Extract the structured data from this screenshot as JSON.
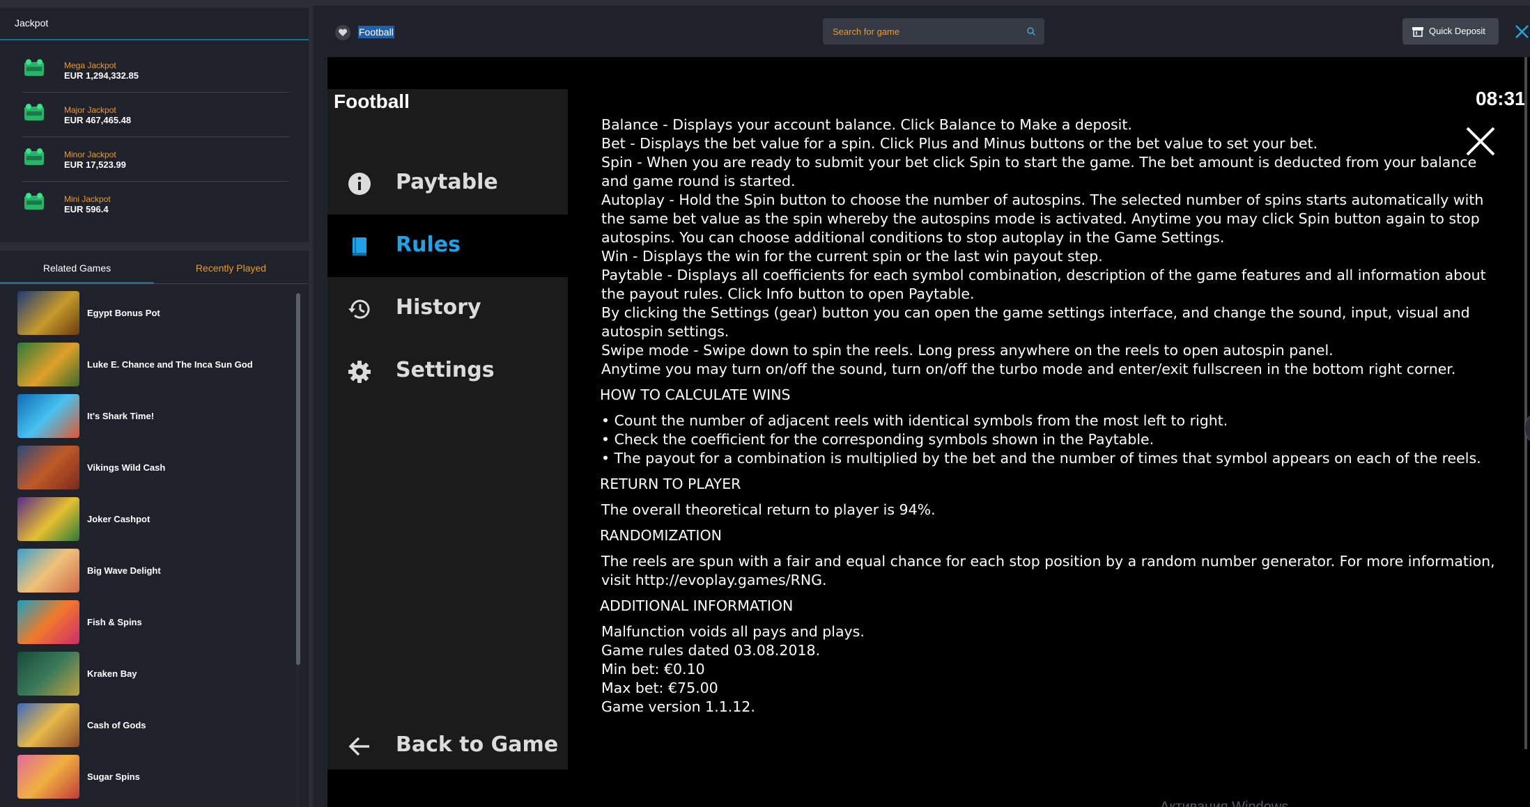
{
  "jackpot": {
    "title": "Jackpot",
    "items": [
      {
        "name": "Mega Jackpot",
        "value": "EUR 1,294,332.85"
      },
      {
        "name": "Major Jackpot",
        "value": "EUR 467,465.48"
      },
      {
        "name": "Minor Jackpot",
        "value": "EUR 17,523.99"
      },
      {
        "name": "Mini Jackpot",
        "value": "EUR 596.4"
      }
    ],
    "icon": "jackpot-badge-icon"
  },
  "games_tabs": {
    "related": "Related Games",
    "recent": "Recently Played"
  },
  "games": [
    {
      "name": "Egypt Bonus Pot"
    },
    {
      "name": "Luke E. Chance and The Inca Sun God"
    },
    {
      "name": "It's Shark Time!"
    },
    {
      "name": "Vikings Wild Cash"
    },
    {
      "name": "Joker Cashpot"
    },
    {
      "name": "Big Wave Delight"
    },
    {
      "name": "Fish & Spins"
    },
    {
      "name": "Kraken Bay"
    },
    {
      "name": "Cash of Gods"
    },
    {
      "name": "Sugar Spins"
    }
  ],
  "topbar": {
    "game_title": "Football",
    "search_placeholder": "Search for game",
    "quick_deposit": "Quick Deposit"
  },
  "rules_screen": {
    "title": "Football",
    "clock": "08:31",
    "menu": [
      {
        "label": "Paytable",
        "icon": "info-icon",
        "active": false
      },
      {
        "label": "Rules",
        "icon": "book-icon",
        "active": true
      },
      {
        "label": "History",
        "icon": "history-icon",
        "active": false
      },
      {
        "label": "Settings",
        "icon": "gear-icon",
        "active": false
      }
    ],
    "back": "Back to Game",
    "intro_lines": [
      "Balance - Displays your account balance. Click Balance to Make a deposit.",
      "Bet - Displays the bet value for a spin. Click Plus and Minus buttons or the bet value to set your bet.",
      "Spin - When you are ready to submit your bet click Spin to start the game. The bet amount is deducted from your balance and game round is started.",
      "Autoplay - Hold the Spin button to choose the number of autospins. The selected number of spins starts automatically with the same bet value as the spin whereby the autospins mode is activated. Anytime you may click Spin button again to stop autospins. You can choose additional conditions to stop autoplay in the Game Settings.",
      "Win - Displays the win for the current spin or the last win payout step.",
      "Paytable - Displays all coefficients for each symbol combination, description of the game features and all information about the payout rules. Click Info button to open Paytable.",
      "By clicking the Settings (gear) button you can open the game settings interface, and change the sound, input, visual and autospin settings.",
      "Swipe mode - Swipe down to spin the reels. Long press anywhere on the reels to open autospin panel.",
      "Anytime you may turn on/off the sound, turn on/off the turbo mode and enter/exit fullscreen in the bottom right corner."
    ],
    "how_title": "HOW TO CALCULATE WINS",
    "how_lines": [
      "• Count the number of adjacent reels with identical symbols from the most left to right.",
      "• Check the coefficient for the corresponding symbols shown in the Paytable.",
      "• The payout for a combination is multiplied by the bet and the number of times that symbol appears on each of the reels."
    ],
    "rtp_title": "RETURN TO PLAYER",
    "rtp_text": "The overall theoretical return to player is 94%.",
    "rand_title": "RANDOMIZATION",
    "rand_text": "The reels are spun with a fair and equal chance for each stop position by a random number generator. For more information, visit http://evoplay.games/RNG.",
    "add_title": "ADDITIONAL INFORMATION",
    "add_lines": [
      "Malfunction voids all pays and plays.",
      "Game rules dated 03.08.2018.",
      "Min bet: €0.10",
      "Max bet: €75.00",
      "Game version 1.1.12."
    ]
  },
  "watermark": "Активация Windows",
  "colors": {
    "accent_orange": "#f29a1f",
    "active_blue": "#1fa3e8",
    "tab_underline": "#1e6e8e",
    "panel_bg": "#1f222b"
  }
}
